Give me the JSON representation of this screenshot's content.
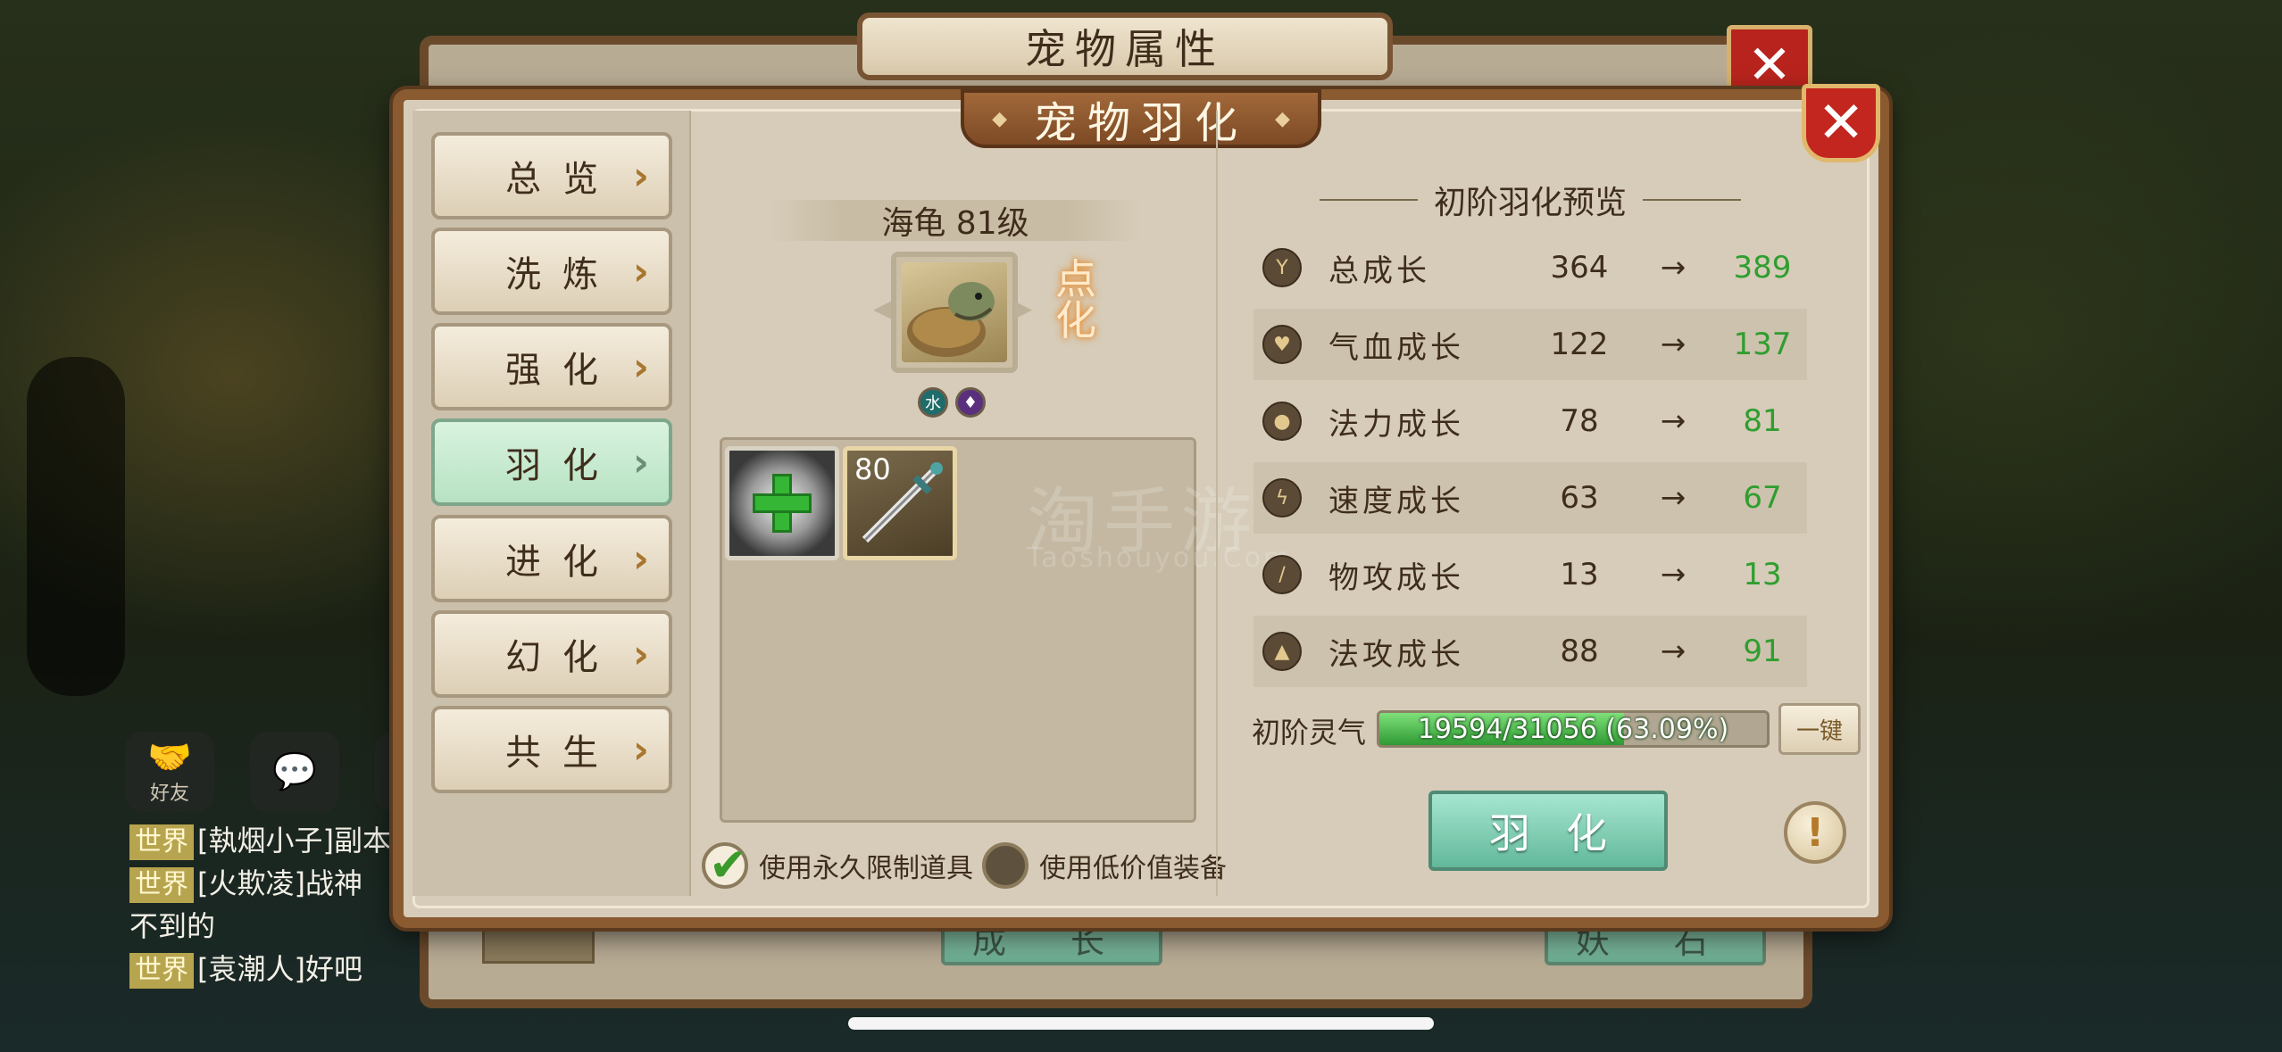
{
  "background_window": {
    "title": "宠物属性",
    "close_glyph": "✕",
    "buttons": [
      "成 长",
      "妖 石"
    ]
  },
  "chat": {
    "icons": [
      {
        "name": "friends-icon",
        "label": "好友"
      },
      {
        "name": "chat-bubble-icon",
        "label": ""
      },
      {
        "name": "microphone-icon",
        "label": ""
      }
    ],
    "lines": [
      {
        "channel": "世界",
        "text": "[執烟小子]副本"
      },
      {
        "channel": "世界",
        "text": "[火欺凌]战神"
      },
      {
        "channel": "",
        "text": "不到的"
      },
      {
        "channel": "世界",
        "text": "[袁潮人]好吧"
      }
    ]
  },
  "dialog": {
    "title": "宠物羽化",
    "close_glyph": "✕",
    "tabs": [
      {
        "label": "总览",
        "active": false
      },
      {
        "label": "洗炼",
        "active": false
      },
      {
        "label": "强化",
        "active": false
      },
      {
        "label": "羽化",
        "active": true
      },
      {
        "label": "进化",
        "active": false
      },
      {
        "label": "幻化",
        "active": false
      },
      {
        "label": "共生",
        "active": false
      }
    ],
    "tab_arrow": "›"
  },
  "pet": {
    "name_level": "海龟 81级",
    "mark": "点化",
    "element_icons": [
      "water-element-icon",
      "purple-element-icon"
    ],
    "element_water_glyph": "水"
  },
  "items": {
    "add_slot_icon": "plus-icon",
    "equipment_level": "80",
    "equipment_icon": "sword-icon"
  },
  "options": {
    "use_permanent": {
      "label": "使用永久限制道具",
      "checked": true
    },
    "use_low_value": {
      "label": "使用低价值装备",
      "checked": false
    }
  },
  "preview": {
    "title": "初阶羽化预览",
    "arrow": "→",
    "stats": [
      {
        "name": "总成长",
        "icon": "total-growth-icon",
        "old": "364",
        "new": "389"
      },
      {
        "name": "气血成长",
        "icon": "heart-icon",
        "old": "122",
        "new": "137"
      },
      {
        "name": "法力成长",
        "icon": "mana-drop-icon",
        "old": "78",
        "new": "81"
      },
      {
        "name": "速度成长",
        "icon": "speed-bolt-icon",
        "old": "63",
        "new": "67"
      },
      {
        "name": "物攻成长",
        "icon": "physical-attack-icon",
        "old": "13",
        "new": "13"
      },
      {
        "name": "法攻成长",
        "icon": "magic-attack-fire-icon",
        "old": "88",
        "new": "91"
      }
    ]
  },
  "aura": {
    "label": "初阶灵气",
    "text": "19594/31056 (63.09%)",
    "progress": 0.6309,
    "onekey_label": "一键"
  },
  "actions": {
    "featherize_label": "羽化",
    "info_glyph": "!"
  },
  "watermark": {
    "text": "淘手游",
    "sub": "Taoshouyou.Com"
  },
  "colors": {
    "increase_green": "#2f9e2f",
    "active_tab": "#c4e8cd",
    "frame_brown": "#8a5a30",
    "close_red": "#c2261f"
  }
}
